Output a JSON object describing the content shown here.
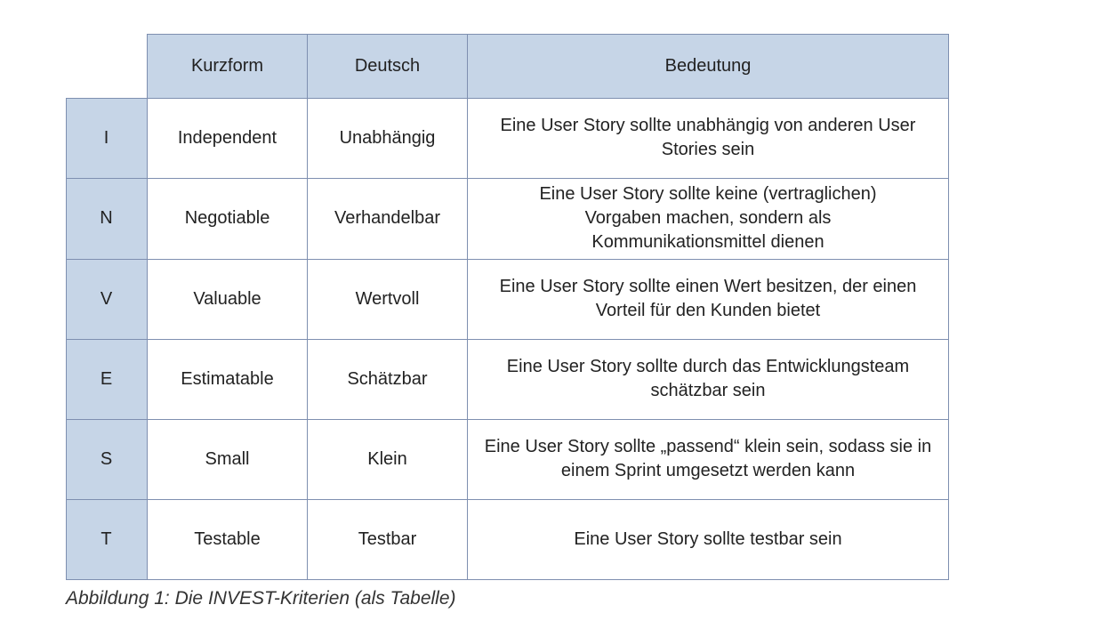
{
  "table": {
    "headers": [
      "Kurzform",
      "Deutsch",
      "Bedeutung"
    ],
    "rows": [
      {
        "letter": "I",
        "kurzform": "Independent",
        "deutsch": "Unabhängig",
        "bedeutung": "Eine User Story sollte unabhängig von anderen User Stories sein"
      },
      {
        "letter": "N",
        "kurzform": "Negotiable",
        "deutsch": "Verhandelbar",
        "bedeutung": "Eine User Story sollte keine (vertraglichen) Vorgaben machen, sondern als Kommunikationsmittel dienen"
      },
      {
        "letter": "V",
        "kurzform": "Valuable",
        "deutsch": "Wertvoll",
        "bedeutung": "Eine User Story sollte einen Wert besitzen, der einen Vorteil für den Kunden bietet"
      },
      {
        "letter": "E",
        "kurzform": "Estimatable",
        "deutsch": "Schätzbar",
        "bedeutung": "Eine User Story sollte durch das Entwicklungsteam schätzbar sein"
      },
      {
        "letter": "S",
        "kurzform": "Small",
        "deutsch": "Klein",
        "bedeutung": "Eine User Story sollte „passend“ klein sein, sodass sie in einem Sprint umgesetzt werden kann"
      },
      {
        "letter": "T",
        "kurzform": "Testable",
        "deutsch": "Testbar",
        "bedeutung": "Eine User Story sollte testbar sein"
      }
    ]
  },
  "caption": "Abbildung 1: Die INVEST-Kriterien (als Tabelle)",
  "colors": {
    "header_bg": "#c6d5e7",
    "border": "#7e8fb0"
  }
}
